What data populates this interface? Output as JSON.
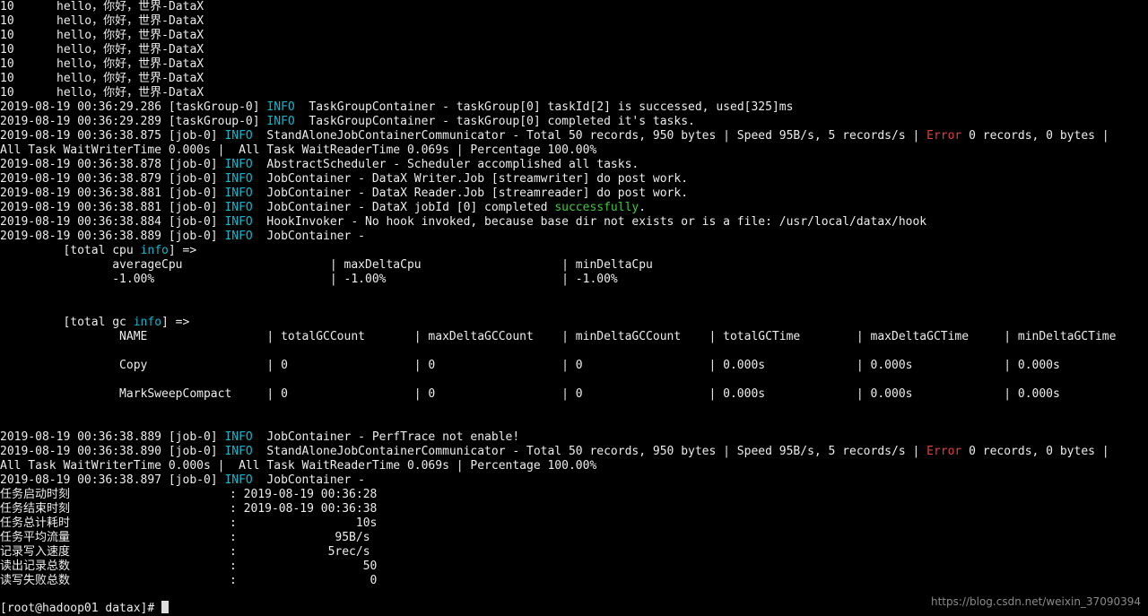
{
  "colors": {
    "background": "#000000",
    "text": "#ececec",
    "info": "#12b5cb",
    "error": "#e04040",
    "success": "#3ec93e"
  },
  "hello_lines": [
    {
      "num": "10",
      "text": "hello，你好，世界-DataX"
    },
    {
      "num": "10",
      "text": "hello，你好，世界-DataX"
    },
    {
      "num": "10",
      "text": "hello，你好，世界-DataX"
    },
    {
      "num": "10",
      "text": "hello，你好，世界-DataX"
    },
    {
      "num": "10",
      "text": "hello，你好，世界-DataX"
    },
    {
      "num": "10",
      "text": "hello，你好，世界-DataX"
    },
    {
      "num": "10",
      "text": "hello，你好，世界-DataX"
    }
  ],
  "log": {
    "taskgroup_1_prefix": "2019-08-19 00:36:29.286 [taskGroup-0] ",
    "taskgroup_1_level": "INFO",
    "taskgroup_1_msg": "  TaskGroupContainer - taskGroup[0] taskId[2] is successed, used[325]ms",
    "taskgroup_2_prefix": "2019-08-19 00:36:29.289 [taskGroup-0] ",
    "taskgroup_2_level": "INFO",
    "taskgroup_2_msg": "  TaskGroupContainer - taskGroup[0] completed it's tasks.",
    "comm_1_prefix": "2019-08-19 00:36:38.875 [job-0] ",
    "comm_1_level": "INFO",
    "comm_1_msg": "  StandAloneJobContainerCommunicator - Total 50 records, 950 bytes | Speed 95B/s, 5 records/s | ",
    "comm_1_error": "Error",
    "comm_1_tail": " 0 records, 0 bytes |",
    "comm_1_cont": "All Task WaitWriterTime 0.000s |  All Task WaitReaderTime 0.069s | Percentage 100.00%",
    "sched_prefix": "2019-08-19 00:36:38.878 [job-0] ",
    "sched_level": "INFO",
    "sched_msg": "  AbstractScheduler - Scheduler accomplished all tasks.",
    "writer_prefix": "2019-08-19 00:36:38.879 [job-0] ",
    "writer_level": "INFO",
    "writer_msg": "  JobContainer - DataX Writer.Job [streamwriter] do post work.",
    "reader_prefix": "2019-08-19 00:36:38.881 [job-0] ",
    "reader_level": "INFO",
    "reader_msg": "  JobContainer - DataX Reader.Job [streamreader] do post work.",
    "completed_prefix": "2019-08-19 00:36:38.881 [job-0] ",
    "completed_level": "INFO",
    "completed_msg": "  JobContainer - DataX jobId [0] completed ",
    "completed_success": "successfully",
    "completed_dot": ".",
    "hook_prefix": "2019-08-19 00:36:38.884 [job-0] ",
    "hook_level": "INFO",
    "hook_msg": "  HookInvoker - No hook invoked, because base dir not exists or is a file: /usr/local/datax/hook",
    "jc_1_prefix": "2019-08-19 00:36:38.889 [job-0] ",
    "jc_1_level": "INFO",
    "jc_1_msg": "  JobContainer -",
    "cpu_title_pre": "         [total cpu ",
    "cpu_title_info": "info",
    "cpu_title_post": "] =>",
    "cpu_header": "                averageCpu                     | maxDeltaCpu                    | minDeltaCpu",
    "cpu_values": "                -1.00%                         | -1.00%                         | -1.00%",
    "gc_title_pre": "         [total gc ",
    "gc_title_info": "info",
    "gc_title_post": "] =>",
    "gc_header": "                 NAME                 | totalGCCount       | maxDeltaGCCount    | minDeltaGCCount    | totalGCTime        | maxDeltaGCTime     | minDeltaGCTime",
    "gc_row_1": "                 Copy                 | 0                  | 0                  | 0                  | 0.000s             | 0.000s             | 0.000s",
    "gc_row_2": "                 MarkSweepCompact     | 0                  | 0                  | 0                  | 0.000s             | 0.000s             | 0.000s",
    "perf_prefix": "2019-08-19 00:36:38.889 [job-0] ",
    "perf_level": "INFO",
    "perf_msg": "  JobContainer - PerfTrace not enable!",
    "comm_2_prefix": "2019-08-19 00:36:38.890 [job-0] ",
    "comm_2_level": "INFO",
    "comm_2_msg": "  StandAloneJobContainerCommunicator - Total 50 records, 950 bytes | Speed 95B/s, 5 records/s | ",
    "comm_2_error": "Error",
    "comm_2_tail": " 0 records, 0 bytes |",
    "comm_2_cont": "All Task WaitWriterTime 0.000s |  All Task WaitReaderTime 0.069s | Percentage 100.00%",
    "jc_2_prefix": "2019-08-19 00:36:38.897 [job-0] ",
    "jc_2_level": "INFO",
    "jc_2_msg": "  JobContainer -"
  },
  "summary": [
    {
      "label": "任务启动时刻",
      "value": ": 2019-08-19 00:36:28"
    },
    {
      "label": "任务结束时刻",
      "value": ": 2019-08-19 00:36:38"
    },
    {
      "label": "任务总计耗时",
      "value": ":                 10s"
    },
    {
      "label": "任务平均流量",
      "value": ":              95B/s"
    },
    {
      "label": "记录写入速度",
      "value": ":             5rec/s"
    },
    {
      "label": "读出记录总数",
      "value": ":                  50"
    },
    {
      "label": "读写失败总数",
      "value": ":                   0"
    }
  ],
  "prompt": {
    "text": "[root@hadoop01 datax]# "
  },
  "watermark": "https://blog.csdn.net/weixin_37090394"
}
